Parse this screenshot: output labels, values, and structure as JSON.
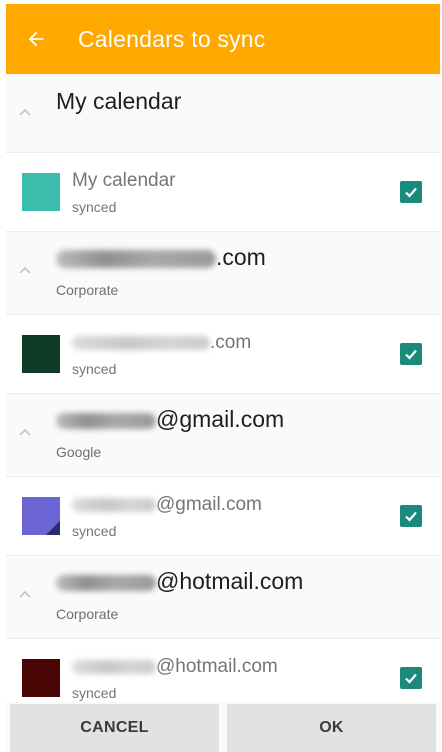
{
  "header": {
    "title": "Calendars to sync",
    "back_icon": "arrow-left-icon"
  },
  "groups": [
    {
      "title": "My calendar",
      "subtitle": "",
      "calendars": [
        {
          "name": "My calendar",
          "status": "synced",
          "color": "#3dbdae",
          "checked": true
        }
      ]
    },
    {
      "title": ".com",
      "subtitle": "Corporate",
      "calendars": [
        {
          "name": ".com",
          "status": "synced",
          "color": "#0f3a26",
          "checked": true
        }
      ]
    },
    {
      "title": "@gmail.com",
      "subtitle": "Google",
      "calendars": [
        {
          "name": "@gmail.com",
          "status": "synced",
          "color": "#6a64d4",
          "checked": true
        }
      ]
    },
    {
      "title": "@hotmail.com",
      "subtitle": "Corporate",
      "calendars": [
        {
          "name": "@hotmail.com",
          "status": "synced",
          "color": "#4a0505",
          "checked": true
        }
      ]
    }
  ],
  "footer": {
    "cancel_label": "CANCEL",
    "ok_label": "OK"
  },
  "colors": {
    "accent": "#ffa800",
    "checkbox": "#1a8a7a"
  }
}
